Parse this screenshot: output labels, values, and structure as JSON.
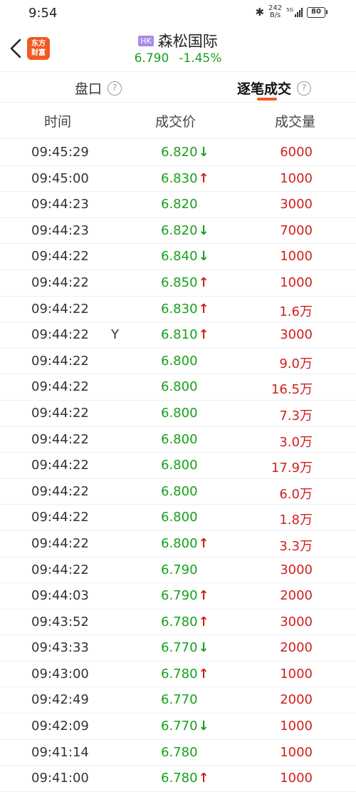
{
  "status_bar": {
    "time": "9:54",
    "net_speed_value": "242",
    "net_speed_unit": "B/s",
    "signal_label": "5G",
    "battery": "80"
  },
  "header": {
    "logo_line1": "东方",
    "logo_line2": "财富",
    "market_badge": "HK",
    "stock_name": "森松国际",
    "price": "6.790",
    "change_pct": "-1.45%"
  },
  "tabs": [
    {
      "label": "盘口",
      "active": false
    },
    {
      "label": "逐笔成交",
      "active": true
    }
  ],
  "columns": {
    "time": "时间",
    "price": "成交价",
    "volume": "成交量"
  },
  "colors": {
    "up": "#d0201d",
    "down": "#17a11a",
    "accent": "#f05a22"
  },
  "trades": [
    {
      "time": "09:45:29",
      "flag": "",
      "price": "6.820",
      "dir": "down",
      "volume": "6000"
    },
    {
      "time": "09:45:00",
      "flag": "",
      "price": "6.830",
      "dir": "up",
      "volume": "1000"
    },
    {
      "time": "09:44:23",
      "flag": "",
      "price": "6.820",
      "dir": "",
      "volume": "3000"
    },
    {
      "time": "09:44:23",
      "flag": "",
      "price": "6.820",
      "dir": "down",
      "volume": "7000"
    },
    {
      "time": "09:44:22",
      "flag": "",
      "price": "6.840",
      "dir": "down",
      "volume": "1000"
    },
    {
      "time": "09:44:22",
      "flag": "",
      "price": "6.850",
      "dir": "up",
      "volume": "1000"
    },
    {
      "time": "09:44:22",
      "flag": "",
      "price": "6.830",
      "dir": "up",
      "volume": "1.6万"
    },
    {
      "time": "09:44:22",
      "flag": "Y",
      "price": "6.810",
      "dir": "up",
      "volume": "3000"
    },
    {
      "time": "09:44:22",
      "flag": "",
      "price": "6.800",
      "dir": "",
      "volume": "9.0万"
    },
    {
      "time": "09:44:22",
      "flag": "",
      "price": "6.800",
      "dir": "",
      "volume": "16.5万"
    },
    {
      "time": "09:44:22",
      "flag": "",
      "price": "6.800",
      "dir": "",
      "volume": "7.3万"
    },
    {
      "time": "09:44:22",
      "flag": "",
      "price": "6.800",
      "dir": "",
      "volume": "3.0万"
    },
    {
      "time": "09:44:22",
      "flag": "",
      "price": "6.800",
      "dir": "",
      "volume": "17.9万"
    },
    {
      "time": "09:44:22",
      "flag": "",
      "price": "6.800",
      "dir": "",
      "volume": "6.0万"
    },
    {
      "time": "09:44:22",
      "flag": "",
      "price": "6.800",
      "dir": "",
      "volume": "1.8万"
    },
    {
      "time": "09:44:22",
      "flag": "",
      "price": "6.800",
      "dir": "up",
      "volume": "3.3万"
    },
    {
      "time": "09:44:22",
      "flag": "",
      "price": "6.790",
      "dir": "",
      "volume": "3000"
    },
    {
      "time": "09:44:03",
      "flag": "",
      "price": "6.790",
      "dir": "up",
      "volume": "2000"
    },
    {
      "time": "09:43:52",
      "flag": "",
      "price": "6.780",
      "dir": "up",
      "volume": "3000"
    },
    {
      "time": "09:43:33",
      "flag": "",
      "price": "6.770",
      "dir": "down",
      "volume": "2000"
    },
    {
      "time": "09:43:00",
      "flag": "",
      "price": "6.780",
      "dir": "up",
      "volume": "1000"
    },
    {
      "time": "09:42:49",
      "flag": "",
      "price": "6.770",
      "dir": "",
      "volume": "2000"
    },
    {
      "time": "09:42:09",
      "flag": "",
      "price": "6.770",
      "dir": "down",
      "volume": "1000"
    },
    {
      "time": "09:41:14",
      "flag": "",
      "price": "6.780",
      "dir": "",
      "volume": "1000"
    },
    {
      "time": "09:41:00",
      "flag": "",
      "price": "6.780",
      "dir": "up",
      "volume": "1000"
    }
  ]
}
